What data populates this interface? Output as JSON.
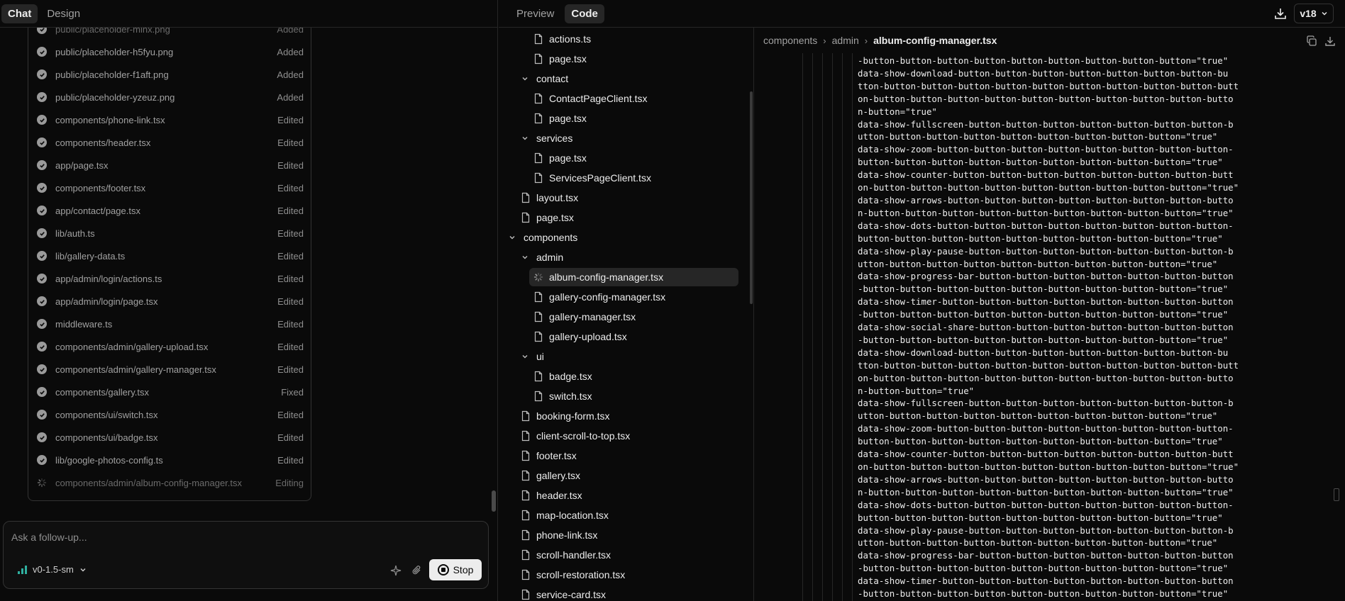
{
  "left": {
    "tabs": [
      {
        "label": "Chat",
        "active": true
      },
      {
        "label": "Design",
        "active": false
      }
    ],
    "files": [
      {
        "path": "public/placeholder-mlnx.png",
        "status": "Added",
        "state": "partial"
      },
      {
        "path": "public/placeholder-h5fyu.png",
        "status": "Added",
        "state": "done"
      },
      {
        "path": "public/placeholder-f1aft.png",
        "status": "Added",
        "state": "done"
      },
      {
        "path": "public/placeholder-yzeuz.png",
        "status": "Added",
        "state": "done"
      },
      {
        "path": "components/phone-link.tsx",
        "status": "Edited",
        "state": "done"
      },
      {
        "path": "components/header.tsx",
        "status": "Edited",
        "state": "done"
      },
      {
        "path": "app/page.tsx",
        "status": "Edited",
        "state": "done"
      },
      {
        "path": "components/footer.tsx",
        "status": "Edited",
        "state": "done"
      },
      {
        "path": "app/contact/page.tsx",
        "status": "Edited",
        "state": "done"
      },
      {
        "path": "lib/auth.ts",
        "status": "Edited",
        "state": "done"
      },
      {
        "path": "lib/gallery-data.ts",
        "status": "Edited",
        "state": "done"
      },
      {
        "path": "app/admin/login/actions.ts",
        "status": "Edited",
        "state": "done"
      },
      {
        "path": "app/admin/login/page.tsx",
        "status": "Edited",
        "state": "done"
      },
      {
        "path": "middleware.ts",
        "status": "Edited",
        "state": "done"
      },
      {
        "path": "components/admin/gallery-upload.tsx",
        "status": "Edited",
        "state": "done"
      },
      {
        "path": "components/admin/gallery-manager.tsx",
        "status": "Edited",
        "state": "done"
      },
      {
        "path": "components/gallery.tsx",
        "status": "Fixed",
        "state": "done"
      },
      {
        "path": "components/ui/switch.tsx",
        "status": "Edited",
        "state": "done"
      },
      {
        "path": "components/ui/badge.tsx",
        "status": "Edited",
        "state": "done"
      },
      {
        "path": "lib/google-photos-config.ts",
        "status": "Edited",
        "state": "done"
      },
      {
        "path": "components/admin/album-config-manager.tsx",
        "status": "Editing",
        "state": "pending"
      }
    ],
    "composer": {
      "placeholder": "Ask a follow-up...",
      "model": "v0-1.5-sm",
      "stop_label": "Stop"
    }
  },
  "right": {
    "tabs": [
      {
        "label": "Preview",
        "active": false
      },
      {
        "label": "Code",
        "active": true
      }
    ],
    "version": "v18",
    "tree": [
      {
        "label": "actions.ts",
        "kind": "file",
        "depth": 2
      },
      {
        "label": "page.tsx",
        "kind": "file",
        "depth": 2
      },
      {
        "label": "contact",
        "kind": "folder",
        "depth": 1
      },
      {
        "label": "ContactPageClient.tsx",
        "kind": "file",
        "depth": 2
      },
      {
        "label": "page.tsx",
        "kind": "file",
        "depth": 2
      },
      {
        "label": "services",
        "kind": "folder",
        "depth": 1
      },
      {
        "label": "page.tsx",
        "kind": "file",
        "depth": 2
      },
      {
        "label": "ServicesPageClient.tsx",
        "kind": "file",
        "depth": 2
      },
      {
        "label": "layout.tsx",
        "kind": "file",
        "depth": 1
      },
      {
        "label": "page.tsx",
        "kind": "file",
        "depth": 1
      },
      {
        "label": "components",
        "kind": "folder",
        "depth": 0
      },
      {
        "label": "admin",
        "kind": "folder",
        "depth": 1
      },
      {
        "label": "album-config-manager.tsx",
        "kind": "loading",
        "depth": 2,
        "selected": true
      },
      {
        "label": "gallery-config-manager.tsx",
        "kind": "file",
        "depth": 2
      },
      {
        "label": "gallery-manager.tsx",
        "kind": "file",
        "depth": 2
      },
      {
        "label": "gallery-upload.tsx",
        "kind": "file",
        "depth": 2
      },
      {
        "label": "ui",
        "kind": "folder",
        "depth": 1
      },
      {
        "label": "badge.tsx",
        "kind": "file",
        "depth": 2
      },
      {
        "label": "switch.tsx",
        "kind": "file",
        "depth": 2
      },
      {
        "label": "booking-form.tsx",
        "kind": "file",
        "depth": 1
      },
      {
        "label": "client-scroll-to-top.tsx",
        "kind": "file",
        "depth": 1
      },
      {
        "label": "footer.tsx",
        "kind": "file",
        "depth": 1
      },
      {
        "label": "gallery.tsx",
        "kind": "file",
        "depth": 1
      },
      {
        "label": "header.tsx",
        "kind": "file",
        "depth": 1
      },
      {
        "label": "map-location.tsx",
        "kind": "file",
        "depth": 1
      },
      {
        "label": "phone-link.tsx",
        "kind": "file",
        "depth": 1
      },
      {
        "label": "scroll-handler.tsx",
        "kind": "file",
        "depth": 1
      },
      {
        "label": "scroll-restoration.tsx",
        "kind": "file",
        "depth": 1
      },
      {
        "label": "service-card.tsx",
        "kind": "file",
        "depth": 1
      }
    ],
    "breadcrumb": [
      "components",
      "admin",
      "album-config-manager.tsx"
    ],
    "code_lines": [
      "-button-button-button-button-button-button-button-button-button=\"true\"",
      "data-show-download-button-button-button-button-button-button-button-bu",
      "tton-button-button-button-button-button-button-button-button-button-butt",
      "on-button-button-button-button-button-button-button-button-button-butto",
      "n-button=\"true\"",
      "data-show-fullscreen-button-button-button-button-button-button-button-b",
      "utton-button-button-button-button-button-button-button-button=\"true\"",
      "data-show-zoom-button-button-button-button-button-button-button-button-",
      "button-button-button-button-button-button-button-button-button=\"true\"",
      "data-show-counter-button-button-button-button-button-button-button-butt",
      "on-button-button-button-button-button-button-button-button-button=\"true\"",
      "data-show-arrows-button-button-button-button-button-button-button-butto",
      "n-button-button-button-button-button-button-button-button-button=\"true\"",
      "data-show-dots-button-button-button-button-button-button-button-button-",
      "button-button-button-button-button-button-button-button-button=\"true\"",
      "data-show-play-pause-button-button-button-button-button-button-button-b",
      "utton-button-button-button-button-button-button-button-button=\"true\"",
      "data-show-progress-bar-button-button-button-button-button-button-button",
      "-button-button-button-button-button-button-button-button-button=\"true\"",
      "data-show-timer-button-button-button-button-button-button-button-button",
      "-button-button-button-button-button-button-button-button-button=\"true\"",
      "data-show-social-share-button-button-button-button-button-button-button",
      "-button-button-button-button-button-button-button-button-button=\"true\"",
      "data-show-download-button-button-button-button-button-button-button-bu",
      "tton-button-button-button-button-button-button-button-button-button-butt",
      "on-button-button-button-button-button-button-button-button-button-butto",
      "n-button-button=\"true\"",
      "data-show-fullscreen-button-button-button-button-button-button-button-b",
      "utton-button-button-button-button-button-button-button-button=\"true\"",
      "data-show-zoom-button-button-button-button-button-button-button-button-",
      "button-button-button-button-button-button-button-button-button=\"true\"",
      "data-show-counter-button-button-button-button-button-button-button-butt",
      "on-button-button-button-button-button-button-button-button-button=\"true\"",
      "data-show-arrows-button-button-button-button-button-button-button-butto",
      "n-button-button-button-button-button-button-button-button-button=\"true\"",
      "data-show-dots-button-button-button-button-button-button-button-button-",
      "button-button-button-button-button-button-button-button-button=\"true\"",
      "data-show-play-pause-button-button-button-button-button-button-button-b",
      "utton-button-button-button-button-button-button-button-button=\"true\"",
      "data-show-progress-bar-button-button-button-button-button-button-button",
      "-button-button-button-button-button-button-button-button-button=\"true\"",
      "data-show-timer-button-button-button-button-button-button-button-button",
      "-button-button-button-button-button-button-button-button-button=\"true\""
    ]
  }
}
